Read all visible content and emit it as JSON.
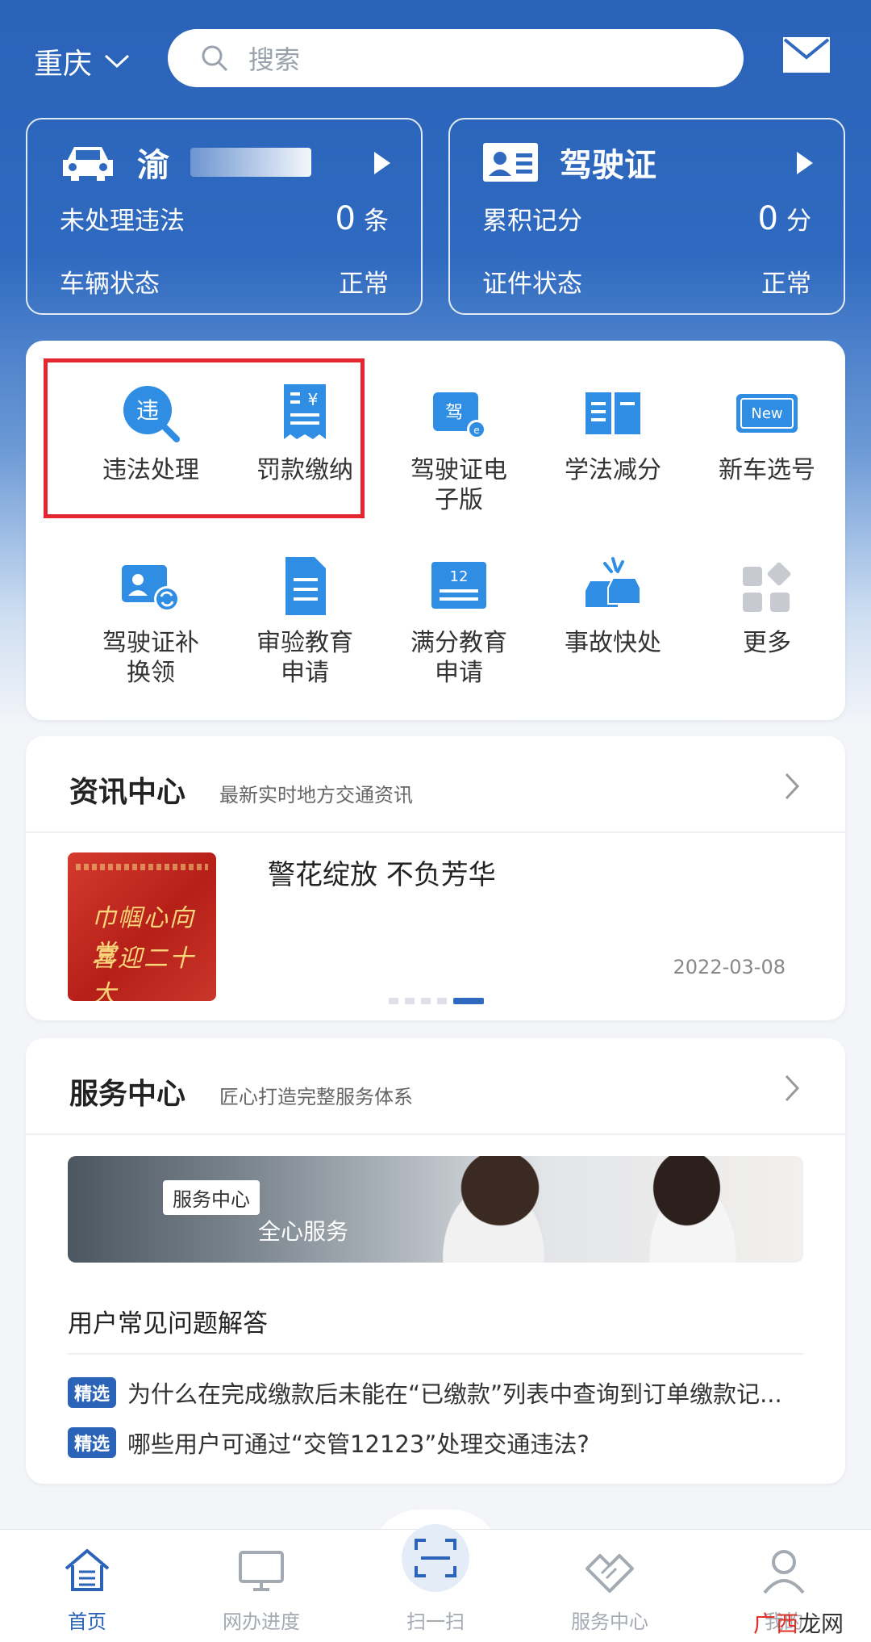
{
  "header": {
    "city": "重庆",
    "search_placeholder": "搜索"
  },
  "vehicle_card": {
    "plate_prefix": "渝",
    "row1_label": "未处理违法",
    "row1_value": "0",
    "row1_unit": "条",
    "row2_label": "车辆状态",
    "row2_value": "正常"
  },
  "license_card": {
    "title": "驾驶证",
    "row1_label": "累积记分",
    "row1_value": "0",
    "row1_unit": "分",
    "row2_label": "证件状态",
    "row2_value": "正常"
  },
  "services": [
    {
      "label": "违法处理",
      "icon": "violation-search-icon"
    },
    {
      "label": "罚款缴纳",
      "icon": "fine-payment-icon"
    },
    {
      "label": "驾驶证电子版",
      "icon": "e-license-icon"
    },
    {
      "label": "学法减分",
      "icon": "book-icon"
    },
    {
      "label": "新车选号",
      "icon": "new-plate-icon"
    },
    {
      "label": "驾驶证补换领",
      "icon": "license-renew-icon"
    },
    {
      "label": "审验教育申请",
      "icon": "document-icon"
    },
    {
      "label": "满分教育申请",
      "icon": "calendar-12-icon"
    },
    {
      "label": "事故快处",
      "icon": "car-accident-icon"
    },
    {
      "label": "更多",
      "icon": "more-grid-icon"
    }
  ],
  "news": {
    "title": "资讯中心",
    "subtitle": "最新实时地方交通资讯",
    "item_title": "警花绽放 不负芳华",
    "item_date": "2022-03-08",
    "image_text_1": "巾帼心向党",
    "image_text_2": "喜迎二十大"
  },
  "service_center": {
    "title": "服务中心",
    "subtitle": "匠心打造完整服务体系",
    "banner_tag": "服务中心",
    "banner_sub": "全心服务",
    "faq_title": "用户常见问题解答",
    "badge": "精选",
    "faqs": [
      "为什么在完成缴款后未能在“已缴款”列表中查询到订单缴款记...",
      "哪些用户可通过“交管12123”处理交通违法?"
    ]
  },
  "bottom_nav": [
    {
      "label": "首页",
      "icon": "home-icon"
    },
    {
      "label": "网办进度",
      "icon": "monitor-icon"
    },
    {
      "label": "扫一扫",
      "icon": "scan-icon"
    },
    {
      "label": "服务中心",
      "icon": "handshake-icon"
    },
    {
      "label": "我的",
      "icon": "user-icon"
    }
  ],
  "watermark": {
    "part1": "广西",
    "part2": "龙网"
  },
  "colors": {
    "primary": "#2a63b8",
    "highlight": "#e3262f",
    "active_nav": "#2a63b8",
    "inactive_nav": "#a4aab2"
  }
}
